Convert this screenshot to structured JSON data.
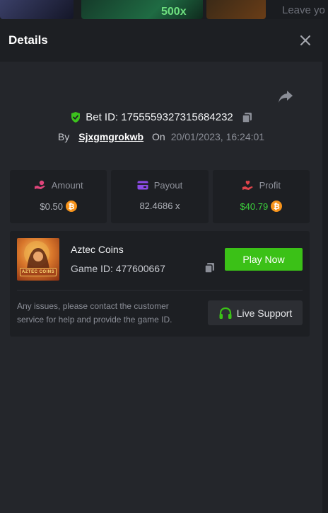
{
  "background": {
    "multiplier_text": "500x",
    "side_text": "Leave yo"
  },
  "header": {
    "title": "Details"
  },
  "bet": {
    "id_label": "Bet ID: 1755559327315684232",
    "by_label": "By",
    "username": "Sjxgmgrokwb",
    "on_label": "On",
    "date": "20/01/2023, 16:24:01"
  },
  "stats": [
    {
      "label": "Amount",
      "value": "$0.50",
      "currency_icon": "bitcoin-icon",
      "icon": "hand-coins-icon",
      "color": "#e0457b"
    },
    {
      "label": "Payout",
      "value": "82.4686 x",
      "icon": "card-icon",
      "color": "#8c4be6"
    },
    {
      "label": "Profit",
      "value": "$40.79",
      "currency_icon": "bitcoin-icon",
      "icon": "hand-heart-icon",
      "color": "#e0454b"
    }
  ],
  "game": {
    "title": "Aztec Coins",
    "id_label": "Game ID: 477600667",
    "thumb_text": "AZTEC COINS",
    "play_label": "Play Now",
    "help_text": "Any issues, please contact the customer service for help and provide the game ID.",
    "support_label": "Live Support"
  },
  "colors": {
    "accent_green": "#3bc117",
    "profit_green": "#3cd13c",
    "bitcoin_orange": "#f7931a"
  }
}
